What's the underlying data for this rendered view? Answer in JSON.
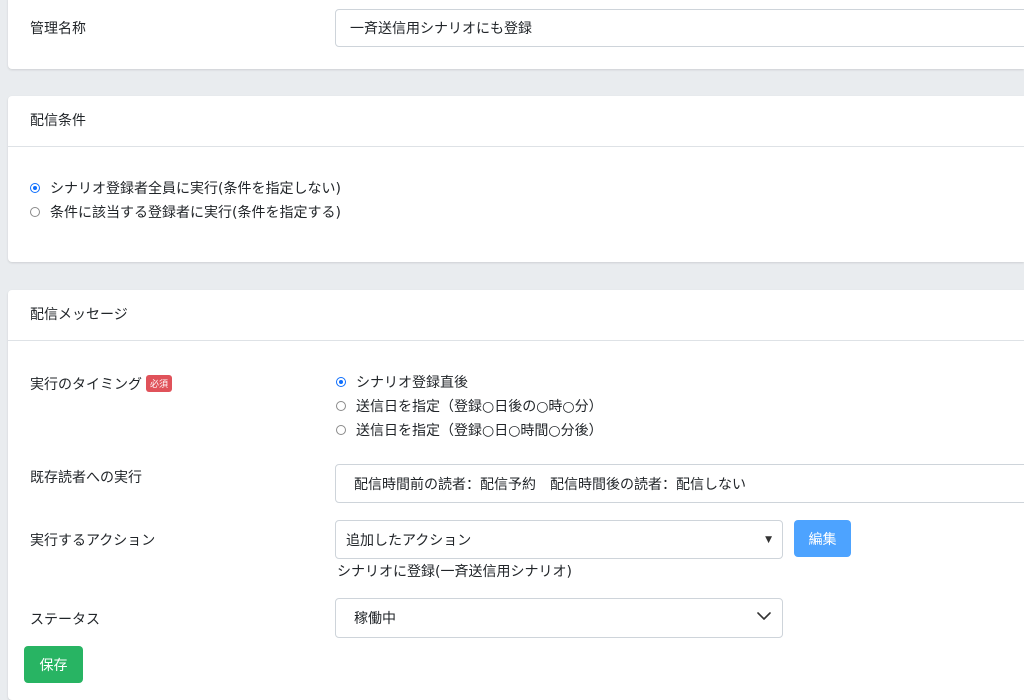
{
  "management_name": {
    "label": "管理名称",
    "value": "一斉送信用シナリオにも登録"
  },
  "delivery_conditions": {
    "title": "配信条件",
    "options": [
      {
        "label": "シナリオ登録者全員に実行(条件を指定しない)",
        "checked": true
      },
      {
        "label": "条件に該当する登録者に実行(条件を指定する)",
        "checked": false
      }
    ]
  },
  "delivery_message": {
    "title": "配信メッセージ",
    "timing": {
      "label": "実行のタイミング",
      "required_badge": "必須",
      "options": [
        {
          "label": "シナリオ登録直後",
          "checked": true
        },
        {
          "label": "送信日を指定（登録○日後の○時○分）",
          "checked": false
        },
        {
          "label": "送信日を指定（登録○日○時間○分後）",
          "checked": false
        }
      ]
    },
    "existing_readers": {
      "label": "既存読者への実行",
      "value": "配信時間前の読者：配信予約　配信時間後の読者：配信しない"
    },
    "action": {
      "label": "実行するアクション",
      "selected": "追加したアクション",
      "edit_button": "編集",
      "description": "シナリオに登録(一斉送信用シナリオ)"
    },
    "status": {
      "label": "ステータス",
      "selected": "稼働中"
    }
  },
  "save_button": "保存",
  "colors": {
    "primary": "#0d6efd",
    "edit_button": "#4da3ff",
    "save_button": "#28b463",
    "badge": "#e0525a"
  }
}
